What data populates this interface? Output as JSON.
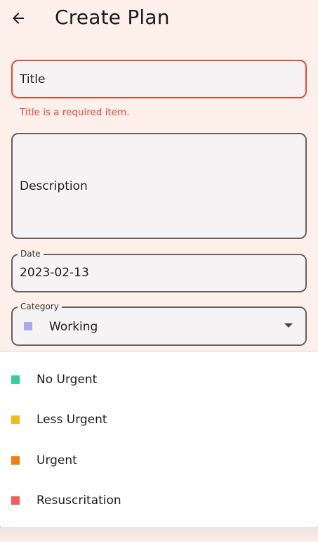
{
  "header": {
    "title": "Create Plan",
    "back_icon": "arrow-left-icon"
  },
  "form": {
    "title_field": {
      "placeholder": "Title",
      "value": "",
      "error": "Title is a required item."
    },
    "description_field": {
      "placeholder": "Description",
      "value": ""
    },
    "date_field": {
      "label": "Date",
      "value": "2023-02-13"
    },
    "category_field": {
      "label": "Category",
      "value": "Working",
      "color": "#a9a7f0"
    }
  },
  "category_menu": {
    "items": [
      {
        "label": "No Urgent",
        "color": "#35cba0"
      },
      {
        "label": "Less Urgent",
        "color": "#eebd1c"
      },
      {
        "label": "Urgent",
        "color": "#f57c0f"
      },
      {
        "label": "Resuscritation",
        "color": "#f45c5c"
      }
    ]
  },
  "colors": {
    "background": "#fdefe9",
    "error": "#e5483e",
    "field_fill": "#f5f3f3",
    "field_border": "#66625f"
  }
}
